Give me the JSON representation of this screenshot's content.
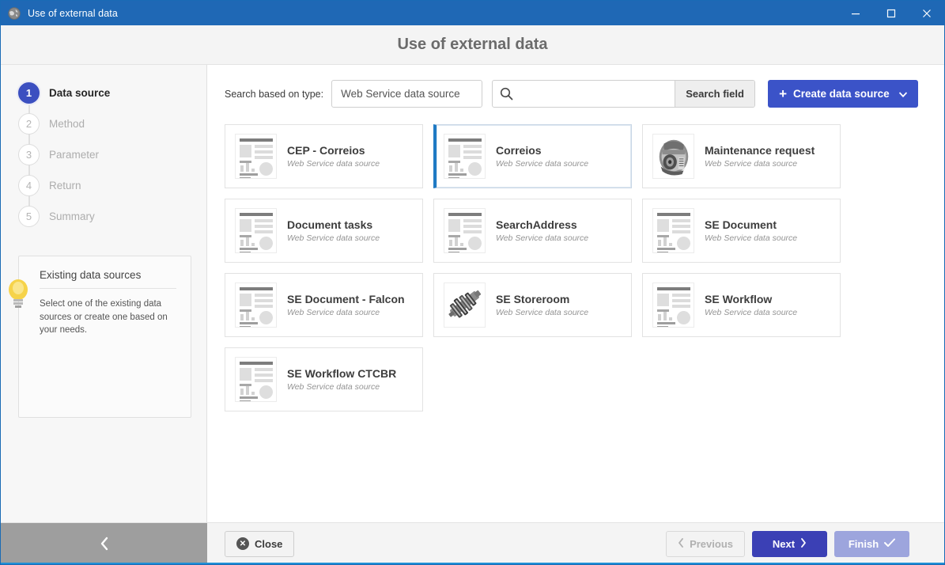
{
  "window": {
    "title": "Use of external data",
    "icon": "globe-icon",
    "controls": {
      "minimize": "minimize-icon",
      "maximize": "maximize-icon",
      "close": "close-icon"
    },
    "titlebar_color": "#1f68b5"
  },
  "header": {
    "title": "Use of external data"
  },
  "sidebar": {
    "steps": [
      {
        "number": "1",
        "label": "Data source",
        "state": "active"
      },
      {
        "number": "2",
        "label": "Method",
        "state": "inactive"
      },
      {
        "number": "3",
        "label": "Parameter",
        "state": "inactive"
      },
      {
        "number": "4",
        "label": "Return",
        "state": "inactive"
      },
      {
        "number": "5",
        "label": "Summary",
        "state": "inactive"
      }
    ],
    "active_step_color": "#3b4fc0",
    "hint": {
      "icon": "lightbulb-icon",
      "title": "Existing data sources",
      "text": "Select one of the existing data sources or create one based on your needs."
    },
    "collapse": {
      "icon": "chevron-left-icon"
    }
  },
  "toolbar": {
    "type_label": "Search based on type:",
    "type_selected": "Web Service data source",
    "type_options": [
      "Web Service data source"
    ],
    "search_icon": "search-icon",
    "search_value": "",
    "search_placeholder": "",
    "search_button": "Search field",
    "create_button": "Create data source",
    "create_plus": "+",
    "create_caret": "caret-down-icon",
    "create_color": "#3b53c8"
  },
  "cards": [
    {
      "title": "CEP - Correios",
      "subtitle": "Web Service data source",
      "thumb": "document-icon",
      "selected": false
    },
    {
      "title": "Correios",
      "subtitle": "Web Service data source",
      "thumb": "document-icon",
      "selected": true
    },
    {
      "title": "Maintenance request",
      "subtitle": "Web Service data source",
      "thumb": "alternator-photo",
      "selected": false
    },
    {
      "title": "Document tasks",
      "subtitle": "Web Service data source",
      "thumb": "document-icon",
      "selected": false
    },
    {
      "title": "SearchAddress",
      "subtitle": "Web Service data source",
      "thumb": "document-icon",
      "selected": false
    },
    {
      "title": "SE Document",
      "subtitle": "Web Service data source",
      "thumb": "document-icon",
      "selected": false
    },
    {
      "title": "SE Document - Falcon",
      "subtitle": "Web Service data source",
      "thumb": "document-icon",
      "selected": false
    },
    {
      "title": "SE Storeroom",
      "subtitle": "Web Service data source",
      "thumb": "crankshaft-photo",
      "selected": false
    },
    {
      "title": "SE Workflow",
      "subtitle": "Web Service data source",
      "thumb": "document-icon",
      "selected": false
    },
    {
      "title": "SE Workflow CTCBR",
      "subtitle": "Web Service data source",
      "thumb": "document-icon",
      "selected": false
    }
  ],
  "footer": {
    "close": "Close",
    "previous": "Previous",
    "next": "Next",
    "finish": "Finish",
    "next_color": "#3b40b5",
    "finish_color": "#9da5dd"
  }
}
